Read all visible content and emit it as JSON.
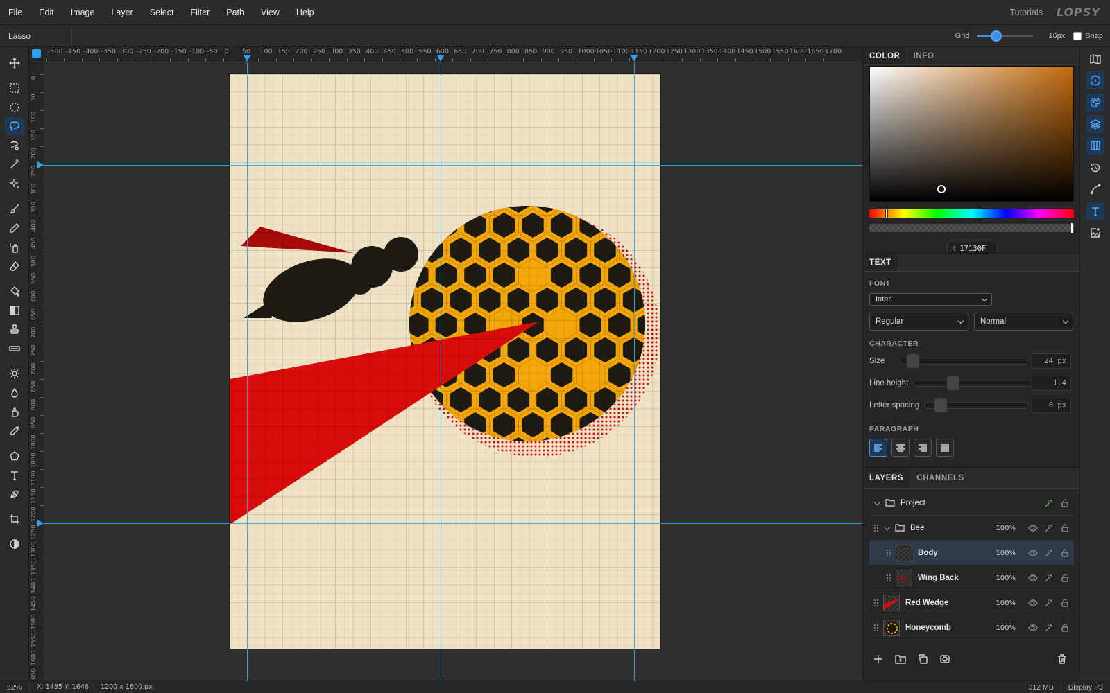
{
  "menubar": {
    "items": [
      "File",
      "Edit",
      "Image",
      "Layer",
      "Select",
      "Filter",
      "Path",
      "View",
      "Help"
    ],
    "tutorials": "Tutorials",
    "logo": "LOPSY"
  },
  "options": {
    "tool_name": "Lasso",
    "grid_label": "Grid",
    "grid_value_fraction": 0.33,
    "grid_size": "16px",
    "snap_label": "Snap",
    "snap_checked": false
  },
  "toolbar": {
    "tools": [
      "move-icon",
      "rect-select-icon",
      "ellipse-select-icon",
      "lasso-icon",
      "magnetic-lasso-icon",
      "magic-wand-icon",
      "quick-select-icon",
      "brush-icon",
      "pencil-icon",
      "spray-icon",
      "eraser-icon",
      "fill-bucket-icon",
      "gradient-icon",
      "stamp-icon",
      "healing-icon",
      "dodge-icon",
      "blur-icon",
      "smudge-icon",
      "eyedropper-icon",
      "polygon-icon",
      "type-icon",
      "pen-icon",
      "crop-icon",
      "contrast-icon"
    ],
    "active": "lasso-icon"
  },
  "rulers": {
    "h_labels": [
      "-500",
      "-450",
      "-400",
      "-350",
      "-300",
      "-250",
      "-200",
      "-150",
      "-100",
      "-50",
      "0",
      "50",
      "100",
      "150",
      "200",
      "250",
      "300",
      "350",
      "400",
      "450",
      "500",
      "550",
      "600",
      "650",
      "700",
      "750",
      "800",
      "850",
      "900",
      "950",
      "1000",
      "1050",
      "1100",
      "1150",
      "1200",
      "1250",
      "1300",
      "1350",
      "1400",
      "1450",
      "1500",
      "1550",
      "1600",
      "1650",
      "1700"
    ],
    "v_labels": [
      "0",
      "50",
      "100",
      "150",
      "200",
      "250",
      "300",
      "350",
      "400",
      "450",
      "500",
      "550",
      "600",
      "650",
      "700",
      "750",
      "800",
      "850",
      "900",
      "950",
      "1000",
      "1050",
      "1100",
      "1150",
      "1200",
      "1250",
      "1300",
      "1350",
      "1400",
      "1450",
      "1500",
      "1550",
      "1600",
      "1650"
    ]
  },
  "document": {
    "background": "#efe2c4",
    "colors": {
      "dark": "#1e1a14",
      "red": "#d90c0c",
      "dark_red": "#a80a0a",
      "honey": "#f5a70a"
    }
  },
  "color_panel": {
    "tabs": [
      "COLOR",
      "INFO"
    ],
    "active_tab": "COLOR",
    "hex_hash": "#",
    "hex": "17130F",
    "hue_fraction": 0.085,
    "saturation": 0.35,
    "brightness": 0.09
  },
  "text_panel": {
    "title": "TEXT",
    "font_label": "FONT",
    "font": "Inter",
    "weight": "Regular",
    "style": "Normal",
    "character_label": "CHARACTER",
    "size_label": "Size",
    "size_value": "24 px",
    "size_fraction": 0.06,
    "line_height_label": "Line height",
    "line_height_value": "1.4",
    "line_height_fraction": 0.27,
    "letter_spacing_label": "Letter spacing",
    "letter_spacing_value": "0 px",
    "letter_spacing_fraction": 0.1,
    "paragraph_label": "PARAGRAPH",
    "align_buttons": [
      "align-left-icon",
      "align-center-icon",
      "align-right-icon",
      "align-justify-icon"
    ],
    "align_active": "align-left-icon"
  },
  "layers_panel": {
    "tabs": [
      "LAYERS",
      "CHANNELS"
    ],
    "active_tab": "LAYERS",
    "layers": [
      {
        "name": "Project",
        "type": "group",
        "opacity": "",
        "depth": 0
      },
      {
        "name": "Bee",
        "type": "group",
        "opacity": "100%",
        "depth": 1
      },
      {
        "name": "Body",
        "type": "layer",
        "opacity": "100%",
        "depth": 2,
        "selected": true
      },
      {
        "name": "Wing Back",
        "type": "layer",
        "opacity": "100%",
        "depth": 2
      },
      {
        "name": "Red Wedge",
        "type": "layer",
        "opacity": "100%",
        "depth": 1
      },
      {
        "name": "Honeycomb",
        "type": "layer",
        "opacity": "100%",
        "depth": 1
      }
    ],
    "footer": [
      "add-layer-icon",
      "add-folder-icon",
      "duplicate-icon",
      "mask-icon",
      "trash-icon"
    ]
  },
  "iconstrip": {
    "icons": [
      "map-icon",
      "info-icon",
      "palette-icon",
      "layers-icon",
      "columns-icon",
      "history-icon",
      "curve-icon",
      "text-icon",
      "image-add-icon"
    ],
    "active": [
      "info-icon",
      "palette-icon",
      "layers-icon",
      "columns-icon",
      "text-icon"
    ]
  },
  "status": {
    "zoom": "52%",
    "coords": "X: 1485 Y: 1646",
    "doc_size": "1200 x 1600",
    "doc_size_unit": "px",
    "memory": "312 MB",
    "color_profile": "Display P3"
  }
}
